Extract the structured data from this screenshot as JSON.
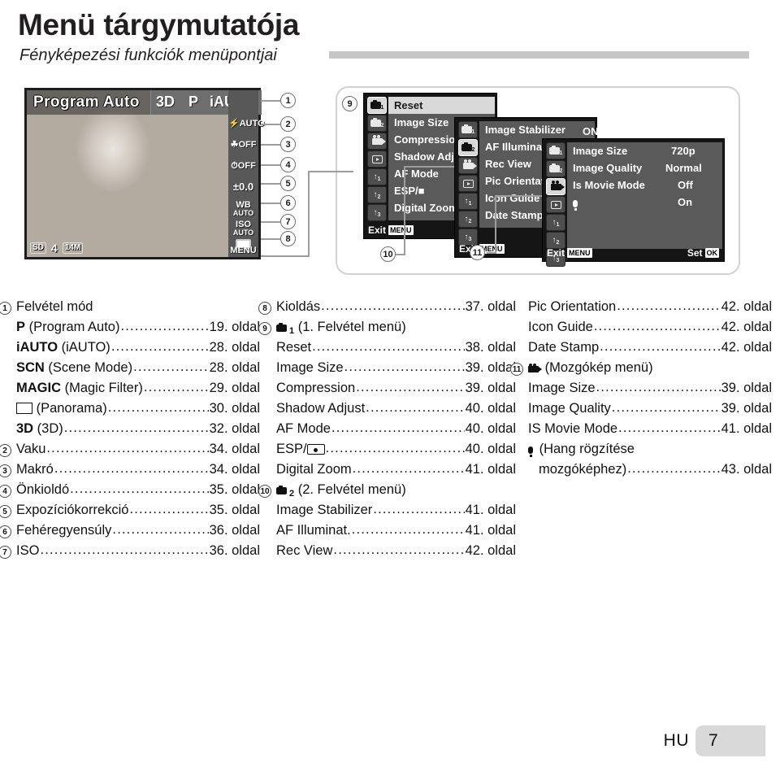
{
  "header": {
    "title": "Menü tárgymutatója",
    "subtitle": "Fényképezési funkciók menüpontjai"
  },
  "diagram": {
    "lcd": {
      "mode_label": "Program Auto",
      "mode_3d": "3D",
      "mode_p": "P",
      "mode_iauto": "iAUTO",
      "side_items": [
        {
          "num": "1",
          "text": "iAUTO"
        },
        {
          "num": "2",
          "text": "AUTO",
          "prefix": "flash"
        },
        {
          "num": "3",
          "text": "OFF",
          "prefix": "macro"
        },
        {
          "num": "4",
          "text": "OFF",
          "prefix": "timer"
        },
        {
          "num": "5",
          "text": "±0.0"
        },
        {
          "num": "6",
          "text": "WB",
          "sub": "AUTO"
        },
        {
          "num": "7",
          "text": "ISO",
          "sub": "AUTO"
        },
        {
          "num": "8",
          "text": "",
          "prefix": "drive"
        }
      ],
      "menu_label": "MENU",
      "sd_badge": "SD",
      "count_badge": "4",
      "size_badge": "14M"
    },
    "menu1": {
      "callout": "9",
      "tabs": [
        "camera1",
        "camera2",
        "movie",
        "playback",
        "wrench1",
        "wrench2",
        "wrench3"
      ],
      "selected_tab": 0,
      "rows": [
        "Reset",
        "Image Size",
        "Compression",
        "Shadow Adjust",
        "AF Mode",
        "ESP/■",
        "Digital Zoom"
      ],
      "exit_label": "Exit",
      "exit_key": "MENU"
    },
    "menu2": {
      "callout": "10",
      "tabs": [
        "camera1",
        "camera2",
        "movie",
        "playback",
        "wrench1",
        "wrench2",
        "wrench3"
      ],
      "selected_tab": 1,
      "rows": [
        "Image Stabilizer",
        "AF Illuminat.",
        "Rec View",
        "Pic Orientation",
        "Icon Guide",
        "Date Stamp"
      ],
      "first_value": "ON",
      "exit_label": "Exit",
      "exit_key": "MENU"
    },
    "menu3": {
      "callout": "11",
      "tabs": [
        "camera1",
        "camera2",
        "movie",
        "playback",
        "wrench1",
        "wrench2",
        "wrench3"
      ],
      "selected_tab": 2,
      "rows": [
        {
          "label": "Image Size",
          "value": "720p"
        },
        {
          "label": "Image Quality",
          "value": "Normal"
        },
        {
          "label": "Is Movie Mode",
          "value": "Off"
        },
        {
          "label": "mic-icon",
          "value": "On"
        }
      ],
      "exit_label": "Exit",
      "exit_key": "MENU",
      "set_label": "Set",
      "set_key": "OK"
    },
    "callout_numbers": [
      "1",
      "2",
      "3",
      "4",
      "5",
      "6",
      "7",
      "8",
      "9",
      "10",
      "11"
    ]
  },
  "index": {
    "page_word": "oldal",
    "col1": [
      {
        "marker": "1",
        "label": "Felvétel mód",
        "page": ""
      },
      {
        "label": "P (Program Auto)",
        "bold_prefix": "P",
        "rest": " (Program Auto)",
        "page": "19."
      },
      {
        "label": "iAUTO (iAUTO)",
        "bold_prefix": "iAUTO",
        "rest": " (iAUTO)",
        "page": "28."
      },
      {
        "label": "SCN (Scene Mode)",
        "bold_prefix": "SCN",
        "rest": " (Scene Mode)",
        "page": "28."
      },
      {
        "label": "MAGIC (Magic Filter)",
        "bold_prefix": "MAGIC",
        "rest": " (Magic Filter)",
        "page": "29."
      },
      {
        "label": "⋈ (Panorama)",
        "bold_prefix": "",
        "rest": " (Panorama)",
        "icon": "panorama-icon",
        "page": "30."
      },
      {
        "label": "3D (3D)",
        "bold_prefix": "3D",
        "rest": " (3D)",
        "page": "32."
      },
      {
        "marker": "2",
        "label": "Vaku",
        "page": "34."
      },
      {
        "marker": "3",
        "label": "Makró",
        "page": "34."
      },
      {
        "marker": "4",
        "label": "Önkioldó",
        "page": "35."
      },
      {
        "marker": "5",
        "label": "Expozíciókorrekció",
        "page": "35."
      },
      {
        "marker": "6",
        "label": "Fehéregyensúly",
        "page": "36."
      },
      {
        "marker": "7",
        "label": "ISO",
        "page": "36."
      }
    ],
    "col2": [
      {
        "marker": "8",
        "label": "Kioldás",
        "page": "37."
      },
      {
        "marker": "9",
        "label": "(1. Felvétel menü)",
        "icon": "camera1-icon",
        "page": ""
      },
      {
        "label": "Reset",
        "page": "38."
      },
      {
        "label": "Image Size",
        "page": "39."
      },
      {
        "label": "Compression",
        "page": "39."
      },
      {
        "label": "Shadow Adjust",
        "page": "40."
      },
      {
        "label": "AF Mode",
        "page": "40."
      },
      {
        "label": "ESP/",
        "icon_after": "esp-icon",
        "page": "40."
      },
      {
        "label": "Digital Zoom",
        "page": "41."
      },
      {
        "marker": "10",
        "label": "(2. Felvétel menü)",
        "icon": "camera2-icon",
        "page": ""
      },
      {
        "label": "Image Stabilizer",
        "page": "41."
      },
      {
        "label": "AF Illuminat.",
        "page": "41."
      },
      {
        "label": "Rec View",
        "page": "42."
      }
    ],
    "col3": [
      {
        "label": "Pic Orientation",
        "page": "42."
      },
      {
        "label": "Icon Guide",
        "page": "42."
      },
      {
        "label": "Date Stamp",
        "page": "42."
      },
      {
        "marker": "11",
        "label": "(Mozgókép menü)",
        "icon": "movie-icon",
        "page": ""
      },
      {
        "label": "Image Size",
        "page": "39."
      },
      {
        "label": "Image Quality",
        "page": "39."
      },
      {
        "label": "IS Movie Mode",
        "page": "41."
      },
      {
        "label": "(Hang rögzítése",
        "icon": "mic-icon",
        "page": "",
        "nodots": true
      },
      {
        "label": "mozgóképhez)",
        "page": "43.",
        "indent": true
      }
    ]
  },
  "footer": {
    "language": "HU",
    "page_number": "7"
  }
}
